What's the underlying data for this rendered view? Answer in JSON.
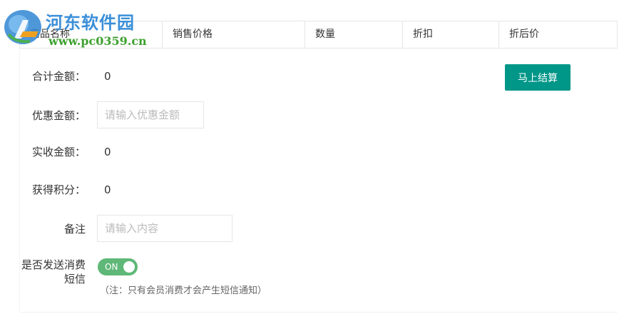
{
  "table": {
    "columns": [
      "商品名称",
      "销售价格",
      "数量",
      "折扣",
      "折后价"
    ]
  },
  "form": {
    "total_label": "合计金额：",
    "total_value": "0",
    "discount_label": "优惠金额：",
    "discount_placeholder": "请输入优惠金额",
    "received_label": "实收金额：",
    "received_value": "0",
    "points_label": "获得积分：",
    "points_value": "0",
    "remark_label": "备注",
    "remark_placeholder": "请输入内容",
    "sms_label": "是否发送消费短信",
    "sms_switch_text": "ON",
    "sms_switch_on": true,
    "sms_note": "（注：只有会员消费才会产生短信通知）"
  },
  "actions": {
    "settle_label": "马上结算"
  },
  "watermark": {
    "title": "河东软件园",
    "url": "www.pc0359.cn"
  },
  "colors": {
    "settle_button": "#009688",
    "switch_on": "#5fb878",
    "watermark_blue": "#3b8fd8",
    "watermark_green": "#3da12e"
  }
}
